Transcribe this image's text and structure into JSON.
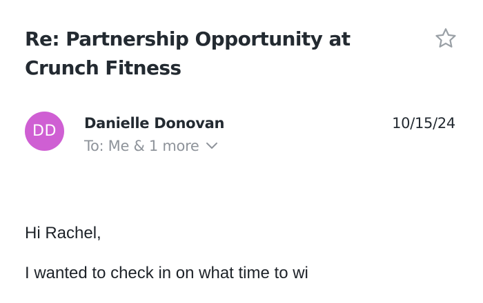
{
  "email": {
    "subject": "Re: Partnership Opportunity at Crunch Fitness",
    "star_icon": "star-outline-icon",
    "sender": {
      "initials": "DD",
      "name": "Danielle Donovan",
      "avatar_color": "#cf5fd3"
    },
    "recipients_label": "To: Me & 1 more",
    "recipients_icon": "chevron-down-icon",
    "date": "10/15/24",
    "body": {
      "greeting": "Hi Rachel,",
      "first_line": "I wanted to check in on what time to wi"
    }
  },
  "colors": {
    "text_primary": "#232a31",
    "text_secondary": "#8e939a",
    "icon_gray": "#9aa0a6"
  }
}
